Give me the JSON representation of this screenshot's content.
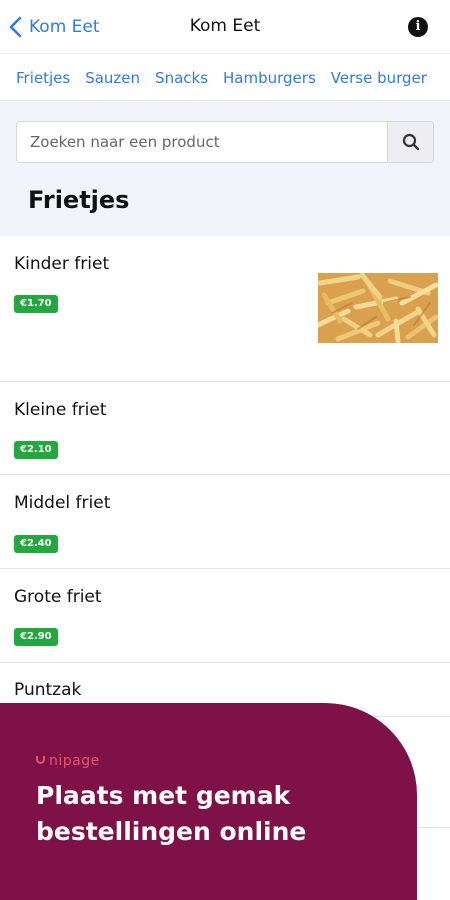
{
  "header": {
    "back_label": "Kom Eet",
    "title": "Kom Eet",
    "info_glyph": "i"
  },
  "tabs": [
    {
      "label": "Frietjes"
    },
    {
      "label": "Sauzen"
    },
    {
      "label": "Snacks"
    },
    {
      "label": "Hamburgers"
    },
    {
      "label": "Verse burger"
    }
  ],
  "search": {
    "placeholder": "Zoeken naar een product"
  },
  "section": {
    "title": "Frietjes"
  },
  "products": [
    {
      "name": "Kinder friet",
      "price": "€1.70"
    },
    {
      "name": "Kleine friet",
      "price": "€2.10"
    },
    {
      "name": "Middel friet",
      "price": "€2.40"
    },
    {
      "name": "Grote friet",
      "price": "€2.90"
    },
    {
      "name": "Puntzak"
    }
  ],
  "promo": {
    "logo": "nipage",
    "line1": "Plaats met gemak",
    "line2": "bestellingen online"
  },
  "colors": {
    "accent_blue": "#2f7be6",
    "price_green": "#22a83f",
    "promo_bg": "#7e1248",
    "logo_red": "#e8526e"
  },
  "icons": {
    "back": "chevron-left-icon",
    "info": "info-icon",
    "search": "search-icon"
  }
}
